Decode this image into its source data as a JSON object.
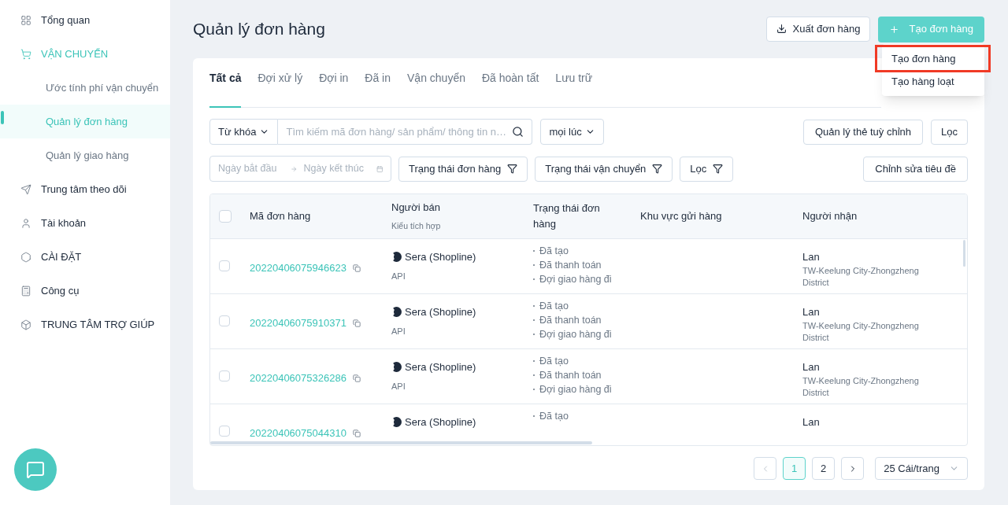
{
  "sidebar": {
    "items": [
      {
        "label": "Tổng quan",
        "selected": false
      },
      {
        "label": "VẬN CHUYỂN",
        "selected": true,
        "expanded": true,
        "children": [
          {
            "label": "Ước tính phí vận chuyển",
            "selected": false
          },
          {
            "label": "Quản lý đơn hàng",
            "selected": true
          },
          {
            "label": "Quản lý giao hàng",
            "selected": false
          }
        ]
      },
      {
        "label": "Trung tâm theo dõi",
        "selected": false
      },
      {
        "label": "Tài khoản",
        "selected": false
      },
      {
        "label": "CÀI ĐẶT",
        "selected": false
      },
      {
        "label": "Công cụ",
        "selected": false
      },
      {
        "label": "TRUNG TÂM TRỢ GIÚP",
        "selected": false
      }
    ]
  },
  "page_title": "Quản lý đơn hàng",
  "export_button": "Xuất đơn hàng",
  "create_button": "Tạo đơn hàng",
  "create_menu": [
    {
      "label": "Tạo đơn hàng",
      "highlighted": true
    },
    {
      "label": "Tạo hàng loạt",
      "highlighted": false
    }
  ],
  "tabs": [
    {
      "label": "Tất cả",
      "selected": true
    },
    {
      "label": "Đợi xử lý",
      "selected": false
    },
    {
      "label": "Đợi in",
      "selected": false
    },
    {
      "label": "Đã in",
      "selected": false
    },
    {
      "label": "Vận chuyển",
      "selected": false
    },
    {
      "label": "Đã hoàn tất",
      "selected": false
    },
    {
      "label": "Lưu trữ",
      "selected": false
    }
  ],
  "filters": {
    "keyword_select": "Từ khóa",
    "search": {
      "placeholder": "Tìm kiếm mã đơn hàng/ sản phẩm/ thông tin n…"
    },
    "time_select": "mọi lúc",
    "manage_tags": "Quản lý thẻ tuỳ chỉnh",
    "filter_button": "Lọc",
    "date_start": {
      "placeholder": "Ngày bắt đầu"
    },
    "date_end": {
      "placeholder": "Ngày kết thúc"
    },
    "order_status": "Trạng thái đơn hàng",
    "shipping_status": "Trạng thái vận chuyển",
    "filter_more": "Lọc",
    "edit_headers": "Chỉnh sửa tiêu đề"
  },
  "table": {
    "all_checked": false,
    "columns": [
      {
        "label": "Mã đơn hàng"
      },
      {
        "label": "Người bán",
        "sub": "Kiểu tích hợp"
      },
      {
        "label": "Trạng thái đơn hàng"
      },
      {
        "label": "Khu vực gửi hàng"
      },
      {
        "label": "Người nhận"
      }
    ],
    "rows": [
      {
        "checked": false,
        "order_id": "20220406075946623",
        "seller": "Sera (Shopline)",
        "integration": "API",
        "statuses": [
          "Đã tạo",
          "Đã thanh toán",
          "Đợi giao hàng đi"
        ],
        "recipient": "Lan",
        "address": "TW-Keelung City-Zhongzheng District"
      },
      {
        "checked": false,
        "order_id": "20220406075910371",
        "seller": "Sera (Shopline)",
        "integration": "API",
        "statuses": [
          "Đã tạo",
          "Đã thanh toán",
          "Đợi giao hàng đi"
        ],
        "recipient": "Lan",
        "address": "TW-Keelung City-Zhongzheng District"
      },
      {
        "checked": false,
        "order_id": "20220406075326286",
        "seller": "Sera (Shopline)",
        "integration": "API",
        "statuses": [
          "Đã tạo",
          "Đã thanh toán",
          "Đợi giao hàng đi"
        ],
        "recipient": "Lan",
        "address": "TW-Keelung City-Zhongzheng District"
      },
      {
        "checked": false,
        "order_id": "20220406075044310",
        "seller": "Sera (Shopline)",
        "statuses": [
          "Đã tạo"
        ],
        "recipient": "Lan"
      }
    ]
  },
  "pagination": {
    "pages": [
      {
        "label": "1",
        "selected": true
      },
      {
        "label": "2",
        "selected": false
      }
    ],
    "page_size": "25 Cái/trang"
  }
}
